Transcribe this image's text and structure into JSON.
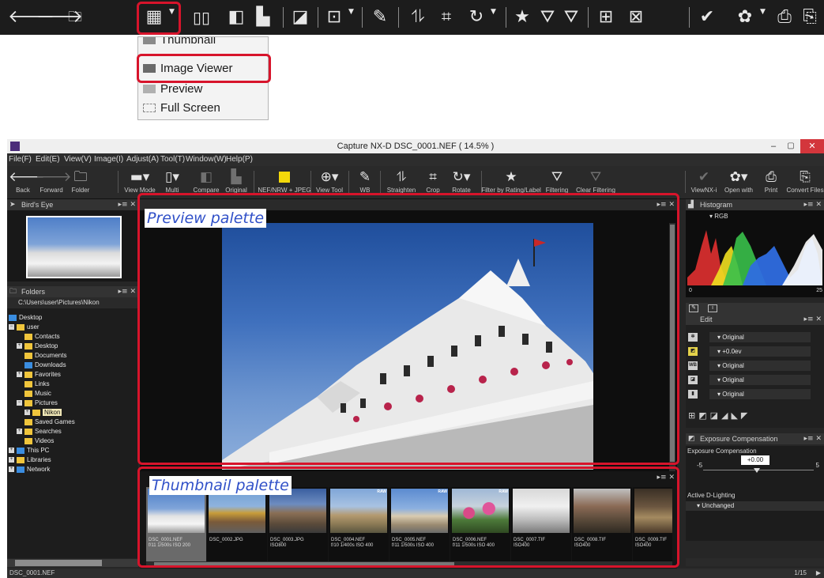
{
  "zoom_toolbar": {
    "icons": [
      "back-arrow-icon",
      "forward-arrow-icon",
      "open-folder-icon",
      "grid-view-icon",
      "multi-view-icon",
      "compare-icon",
      "original-icon",
      "nef-jpeg-icon",
      "view-tool-icon",
      "white-balance-icon",
      "straighten-icon",
      "crop-icon",
      "rotate-icon",
      "star-icon",
      "filter-icon",
      "clear-filter-icon",
      "batch-icon",
      "delete-batch-icon",
      "viewnx-icon",
      "app-icon",
      "print-icon",
      "convert-icon"
    ],
    "menu_items": [
      "Thumbnail",
      "Image Viewer",
      "Preview",
      "Full Screen"
    ]
  },
  "window": {
    "title": "Capture NX-D     DSC_0001.NEF ( 14.5% )",
    "minimize": "–",
    "maximize": "▢",
    "close": "✕"
  },
  "menubar": [
    "File(F)",
    "Edit(E)",
    "View(V)",
    "Image(I)",
    "Adjust(A)",
    "Tool(T)",
    "Window(W)",
    "Help(P)"
  ],
  "toolbar": {
    "back": "Back",
    "forward": "Forward",
    "folder": "Folder",
    "view_mode": "View Mode",
    "multi": "Multi",
    "compare": "Compare",
    "original": "Original",
    "nef_jpeg": "NEF/NRW + JPEG",
    "view_tool": "View Tool",
    "wb": "WB",
    "straighten": "Straighten",
    "crop": "Crop",
    "rotate": "Rotate",
    "filter_rating": "Filter by Rating/Label",
    "filtering": "Filtering",
    "clear_filtering": "Clear Filtering",
    "viewnx": "ViewNX-i",
    "open_with": "Open with",
    "print": "Print",
    "convert_files": "Convert Files"
  },
  "birds_eye": {
    "title": "Bird's Eye"
  },
  "folders": {
    "title": "Folders",
    "path": "C:\\Users\\user\\Pictures\\Nikon",
    "tree": [
      "Desktop",
      "user",
      "Contacts",
      "Desktop",
      "Documents",
      "Downloads",
      "Favorites",
      "Links",
      "Music",
      "Pictures",
      "Nikon",
      "Saved Games",
      "Searches",
      "Videos",
      "This PC",
      "Libraries",
      "Network"
    ]
  },
  "preview": {
    "annotation": "Preview palette"
  },
  "thumbnails": {
    "annotation": "Thumbnail palette",
    "items": [
      {
        "name": "DSC_0001.NEF",
        "meta": "f/11 1/500s ISO 200",
        "raw": ""
      },
      {
        "name": "DSC_0002.JPG",
        "meta": "",
        "raw": ""
      },
      {
        "name": "DSC_0003.JPG",
        "meta": "ISO800",
        "raw": ""
      },
      {
        "name": "DSC_0004.NEF",
        "meta": "f/10 1/400s ISO 400",
        "raw": "RAW"
      },
      {
        "name": "DSC_0005.NEF",
        "meta": "f/11 1/500s ISO 400",
        "raw": "RAW"
      },
      {
        "name": "DSC_0006.NEF",
        "meta": "f/11 1/500s ISO 400",
        "raw": "RAW"
      },
      {
        "name": "DSC_0007.TIF",
        "meta": "ISO400",
        "raw": ""
      },
      {
        "name": "DSC_0008.TIF",
        "meta": "ISO400",
        "raw": ""
      },
      {
        "name": "DSC_0009.TIF",
        "meta": "ISO400",
        "raw": ""
      }
    ]
  },
  "histogram": {
    "title": "Histogram",
    "channel": "RGB",
    "min": "0",
    "max": "25"
  },
  "edit": {
    "title": "Edit",
    "rows": [
      "Original",
      "+0.0ev",
      "Original",
      "Original",
      "Original"
    ],
    "row_icons": [
      "gear-icon",
      "exposure-icon",
      "wb-icon",
      "picture-control-icon",
      "level-icon"
    ]
  },
  "exposure": {
    "title": "Exposure Compensation",
    "label": "Exposure Compensation",
    "value": "+0.00",
    "min": "-5",
    "max": "5"
  },
  "active_d_lighting": {
    "label": "Active D-Lighting",
    "value": "Unchanged"
  },
  "status": {
    "file": "DSC_0001.NEF",
    "page": "1/15"
  },
  "colors": {
    "highlight": "#d7142b",
    "annotation_text": "#3050c8",
    "app_bg": "#262626"
  }
}
